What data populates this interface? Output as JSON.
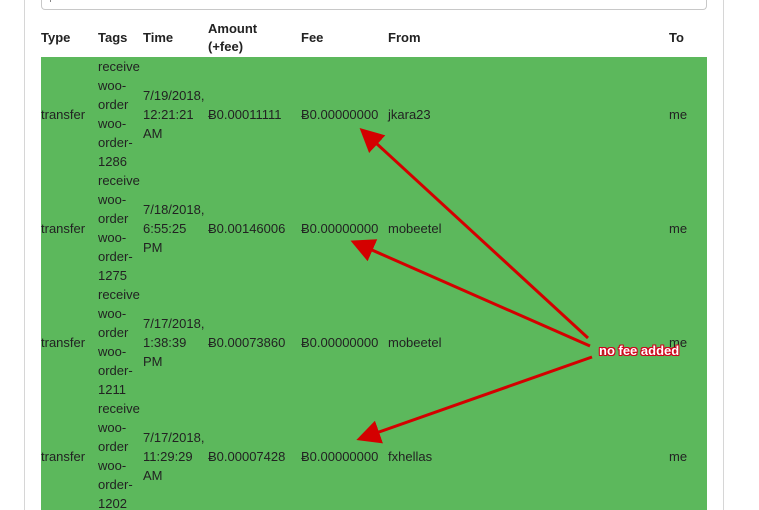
{
  "table": {
    "headers": {
      "type": "Type",
      "tags": "Tags",
      "time": "Time",
      "amount_line1": "Amount",
      "amount_line2": "(+fee)",
      "fee": "Fee",
      "from": "From",
      "to": "To"
    },
    "rows": [
      {
        "type": "transfer",
        "tags": [
          "receive",
          "woo-",
          "order",
          "woo-",
          "order-",
          "1286"
        ],
        "time": [
          "7/19/2018,",
          "12:21:21",
          "AM"
        ],
        "amount": "Ƀ0.00011111",
        "fee": "Ƀ0.00000000",
        "from": "jkara23",
        "to": "me"
      },
      {
        "type": "transfer",
        "tags": [
          "receive",
          "woo-",
          "order",
          "woo-",
          "order-",
          "1275"
        ],
        "time": [
          "7/18/2018,",
          "6:55:25",
          "PM"
        ],
        "amount": "Ƀ0.00146006",
        "fee": "Ƀ0.00000000",
        "from": "mobeetel",
        "to": "me"
      },
      {
        "type": "transfer",
        "tags": [
          "receive",
          "woo-",
          "order",
          "woo-",
          "order-",
          "1211"
        ],
        "time": [
          "7/17/2018,",
          "1:38:39",
          "PM"
        ],
        "amount": "Ƀ0.00073860",
        "fee": "Ƀ0.00000000",
        "from": "mobeetel",
        "to": "me"
      },
      {
        "type": "transfer",
        "tags": [
          "receive",
          "woo-",
          "order",
          "woo-",
          "order-",
          "1202"
        ],
        "time": [
          "7/17/2018,",
          "11:29:29",
          "AM"
        ],
        "amount": "Ƀ0.00007428",
        "fee": "Ƀ0.00000000",
        "from": "fxhellas",
        "to": "me"
      }
    ]
  },
  "annotation": {
    "text": "no fee added"
  },
  "colors": {
    "row_background": "#5cb85c",
    "annotation_red": "#d0021b",
    "arrow_red": "#d40000"
  }
}
